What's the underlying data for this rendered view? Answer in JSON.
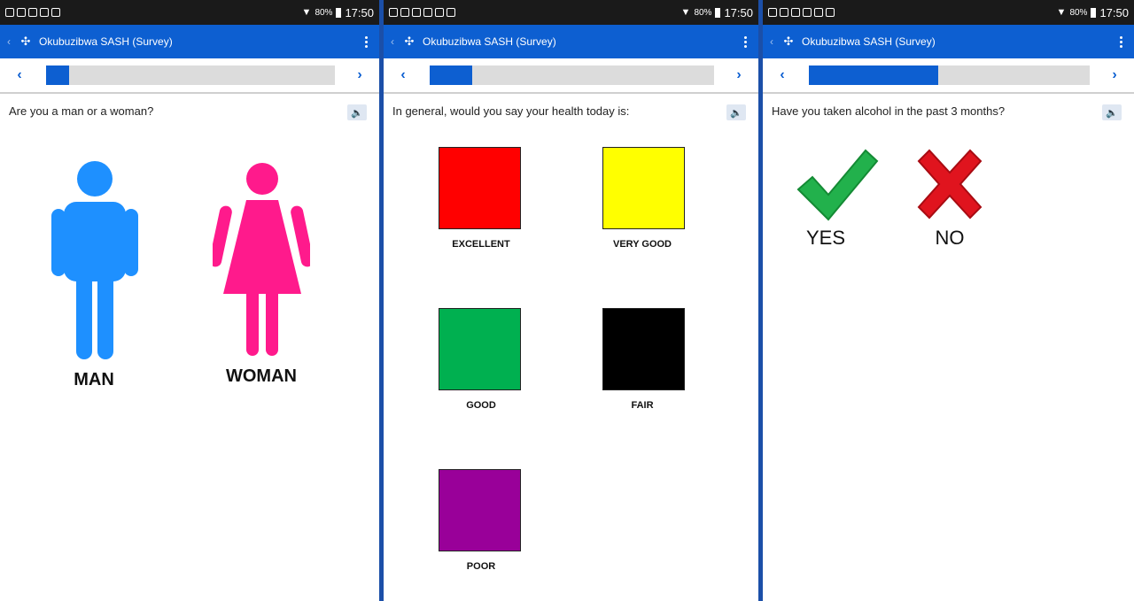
{
  "status_bar": {
    "signal_icon": "signal-icon",
    "battery_percent": "80%",
    "time": "17:50"
  },
  "app": {
    "title": "Okubuzibwa SASH (Survey)",
    "logo_icon": "survey-logo-icon",
    "brand_color": "#0d5fd1"
  },
  "screens": [
    {
      "question": "Are you a man or a woman?",
      "progress": 0.08,
      "options": [
        {
          "label": "MAN",
          "icon": "man-icon",
          "color": "#1e90ff"
        },
        {
          "label": "WOMAN",
          "icon": "woman-icon",
          "color": "#ff1a8c"
        }
      ]
    },
    {
      "question": "In general, would you say your health today is:",
      "progress": 0.15,
      "options": [
        {
          "label": "EXCELLENT",
          "color": "#ff0000"
        },
        {
          "label": "VERY GOOD",
          "color": "#ffff00"
        },
        {
          "label": "GOOD",
          "color": "#00b050"
        },
        {
          "label": "FAIR",
          "color": "#000000"
        },
        {
          "label": "POOR",
          "color": "#990099"
        }
      ]
    },
    {
      "question": "Have you taken alcohol in the past 3 months?",
      "progress": 0.46,
      "options": [
        {
          "label": "YES",
          "icon": "checkmark-icon",
          "color": "#22b14c"
        },
        {
          "label": "NO",
          "icon": "cross-icon",
          "color": "#e0141e"
        }
      ]
    }
  ]
}
